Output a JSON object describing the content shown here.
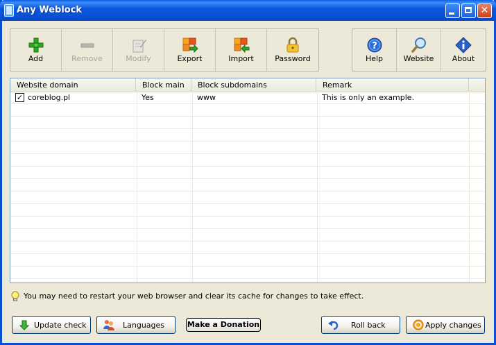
{
  "window": {
    "title": "Any Weblock"
  },
  "toolbar": {
    "left": [
      {
        "label": "Add",
        "icon": "add-icon",
        "enabled": true
      },
      {
        "label": "Remove",
        "icon": "remove-icon",
        "enabled": false
      },
      {
        "label": "Modify",
        "icon": "modify-icon",
        "enabled": false
      },
      {
        "label": "Export",
        "icon": "export-icon",
        "enabled": true
      },
      {
        "label": "Import",
        "icon": "import-icon",
        "enabled": true
      },
      {
        "label": "Password",
        "icon": "lock-icon",
        "enabled": true
      }
    ],
    "right": [
      {
        "label": "Help",
        "icon": "help-icon"
      },
      {
        "label": "Website",
        "icon": "magnifier-icon"
      },
      {
        "label": "About",
        "icon": "info-icon"
      }
    ]
  },
  "table": {
    "columns": [
      "Website domain",
      "Block main",
      "Block subdomains",
      "Remark"
    ],
    "rows": [
      {
        "checked": true,
        "domain": "coreblog.pl",
        "block_main": "Yes",
        "block_subdomains": "www",
        "remark": "This is only an example."
      }
    ]
  },
  "hint": {
    "text": "You may need to restart your web browser and clear its cache for changes to take effect."
  },
  "buttons": {
    "update_check": "Update check",
    "languages": "Languages",
    "donate": "Make a Donation",
    "roll_back": "Roll back",
    "apply_changes": "Apply changes"
  }
}
